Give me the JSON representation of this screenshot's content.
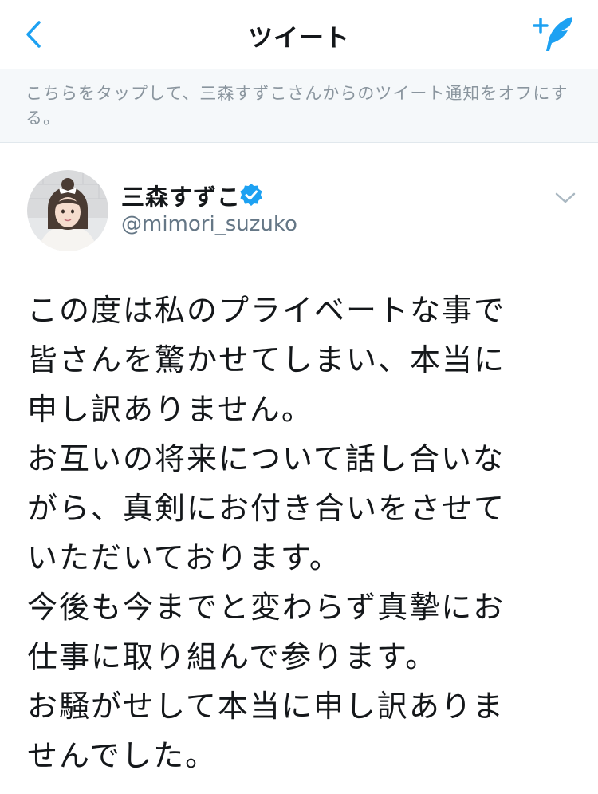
{
  "nav": {
    "title": "ツイート",
    "back_icon": "chevron-left-icon",
    "compose_icon": "compose-tweet-icon",
    "accent_color": "#1da1f2"
  },
  "notice": {
    "text": "こちらをタップして、三森すずこさんからのツイート通知をオフにする。"
  },
  "author": {
    "display_name": "三森すずこ",
    "handle": "@mimori_suzuko",
    "verified_icon": "verified-badge-icon",
    "menu_icon": "chevron-down-icon"
  },
  "tweet": {
    "lines": [
      "この度は私のプライベートな事で",
      "皆さんを驚かせてしまい、本当に",
      "申し訳ありません。",
      "お互いの将来について話し合いな",
      "がら、真剣にお付き合いをさせて",
      "いただいております。",
      "今後も今までと変わらず真摯にお",
      "仕事に取り組んで参ります。",
      "お騒がせして本当に申し訳ありま",
      "せんでした。"
    ]
  }
}
